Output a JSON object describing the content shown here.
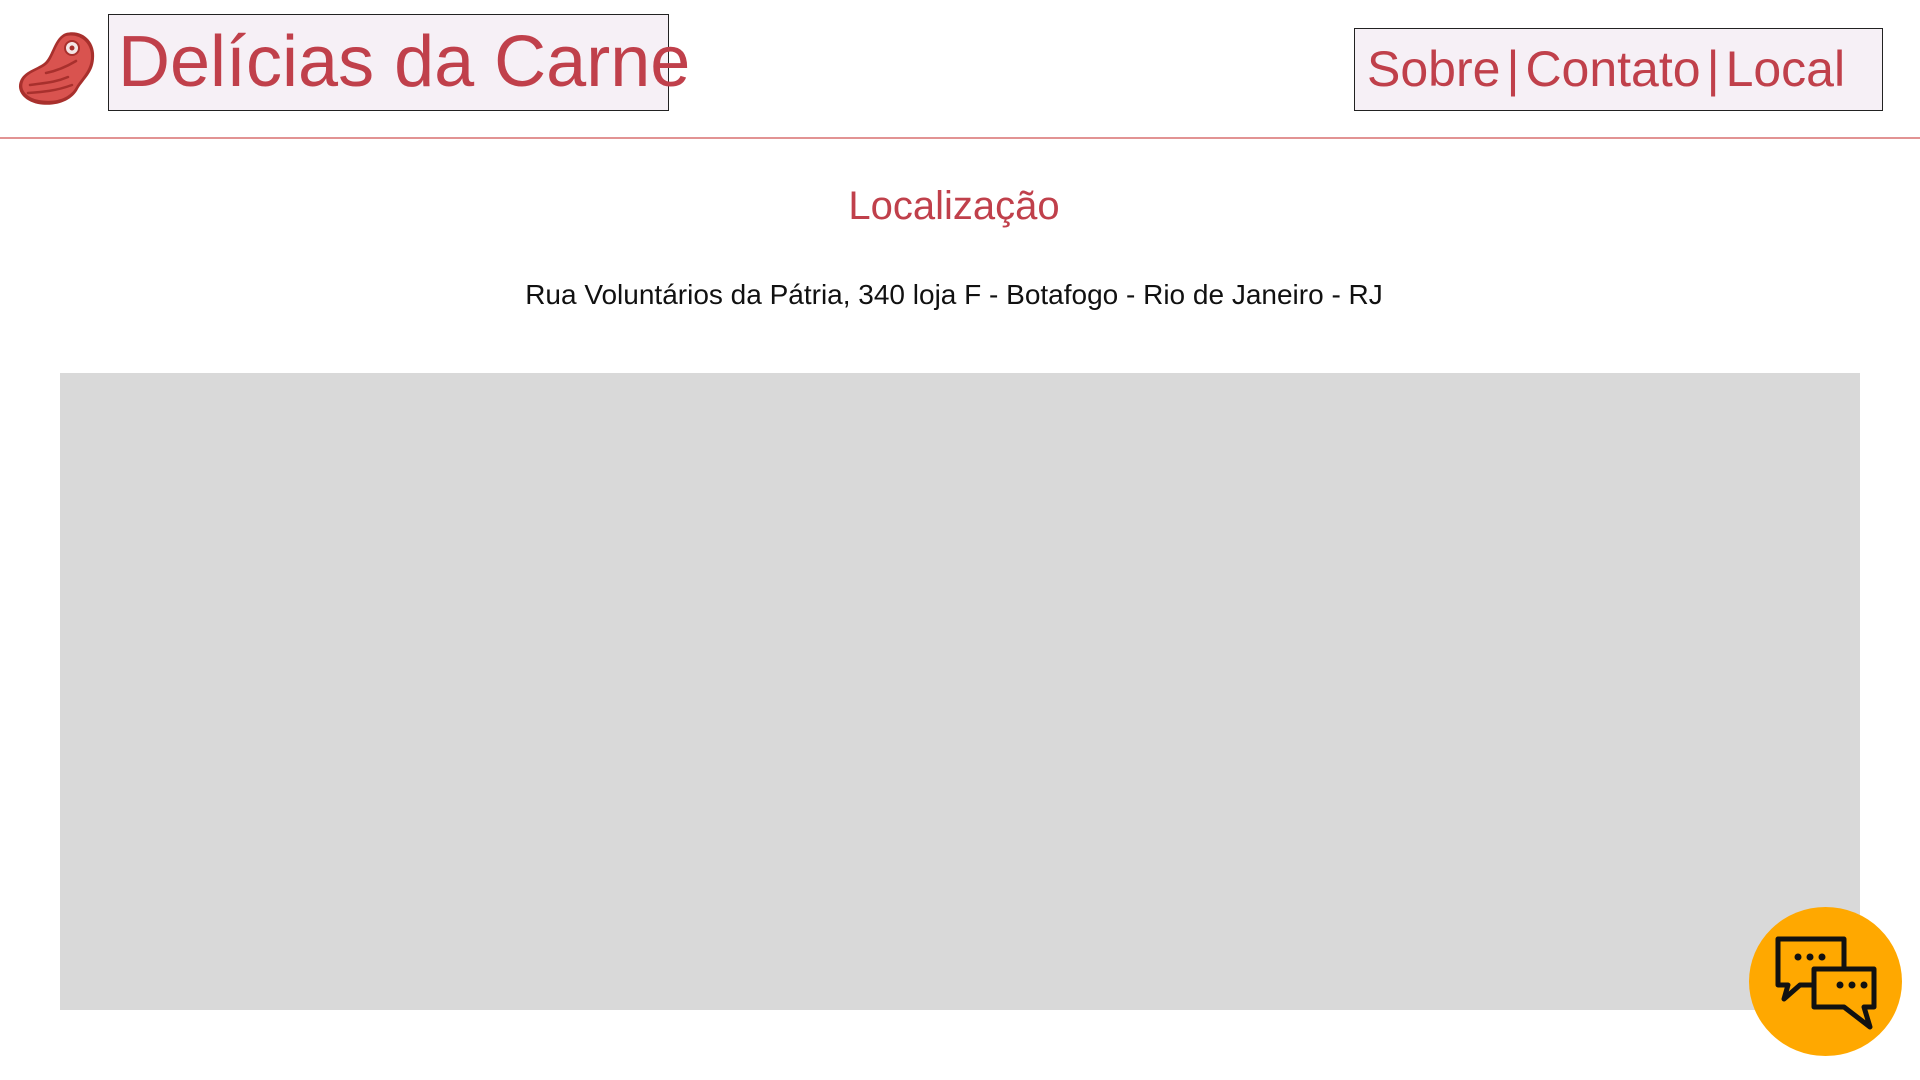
{
  "header": {
    "brand": "Delícias da Carne",
    "logo_icon": "meat-steak-icon",
    "nav": {
      "sobre": "Sobre",
      "contato": "Contato",
      "local": "Local",
      "separator": "|"
    }
  },
  "main": {
    "title": "Localização",
    "address": "Rua Voluntários da Pátria, 340 loja F - Botafogo - Rio de Janeiro - RJ"
  },
  "chat_button": {
    "icon": "chat-bubbles-icon"
  },
  "colors": {
    "accent": "#c0404b",
    "header_box_bg": "#f6f0f6",
    "header_border": "#e29393",
    "map_placeholder": "#d9d9d9",
    "chat_button": "#ffa800"
  }
}
